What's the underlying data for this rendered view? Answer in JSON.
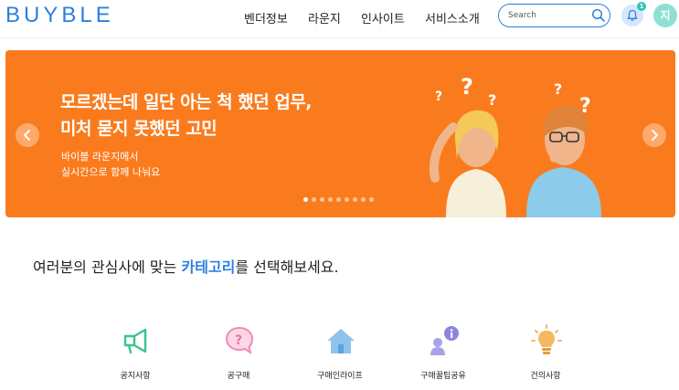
{
  "header": {
    "logo": "BUYBLE",
    "nav": [
      {
        "label": "벤더정보"
      },
      {
        "label": "라운지"
      },
      {
        "label": "인사이트"
      },
      {
        "label": "서비스소개"
      }
    ],
    "search": {
      "placeholder": "Search"
    },
    "notification_count": "1",
    "avatar_initial": "지"
  },
  "banner": {
    "title_line1": "모르겠는데 일단 아는 척 했던 업무,",
    "title_line2": "미처 묻지 못했던 고민",
    "sub_line1": "바이블 라운지에서",
    "sub_line2": "실시간으로 함께 나눠요",
    "slide_count": 9,
    "active_slide": 1,
    "background_color": "#fa7b1d"
  },
  "categories_section": {
    "title_before": "여러분의 관심사에 맞는 ",
    "title_accent": "카테고리",
    "title_after": "를 선택해보세요.",
    "items": [
      {
        "label": "공지사항",
        "icon": "megaphone-icon"
      },
      {
        "label": "공구매",
        "icon": "speech-question-icon"
      },
      {
        "label": "구매인라이프",
        "icon": "house-icon"
      },
      {
        "label": "구매꿀팁공유",
        "icon": "info-share-icon"
      },
      {
        "label": "건의사항",
        "icon": "lightbulb-icon"
      }
    ]
  },
  "colors": {
    "accent": "#2c7fe0",
    "banner": "#fa7b1d",
    "badge": "#2ec4b6"
  }
}
